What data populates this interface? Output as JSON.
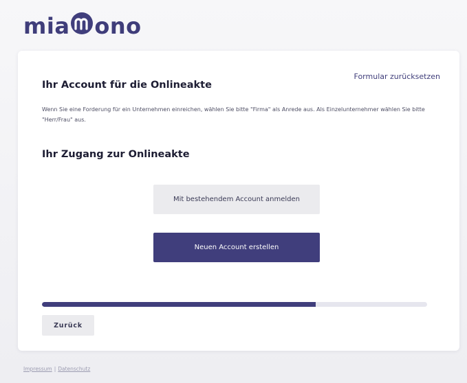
{
  "logo": {
    "text_before": "mia",
    "text_after": "ono"
  },
  "colors": {
    "brand": "#403e7c",
    "progress_track": "#e6e6ee",
    "secondary_button_bg": "#ebebee"
  },
  "card": {
    "reset_link": "Formular zurücksetzen",
    "title": "Ihr Account für die Onlineakte",
    "info": "Wenn Sie eine Forderung für ein Unternehmen einreichen, wählen Sie bitte \"Firma\" als Anrede aus. Als Einzelunternehmer wählen Sie bitte \"Herr/Frau\" aus.",
    "subtitle": "Ihr Zugang zur Onlineakte",
    "login_button": "Mit bestehendem Account anmelden",
    "create_button": "Neuen Account erstellen",
    "progress": 0.71,
    "back_button": "Zurück"
  },
  "footer": {
    "impressum": "Impressum",
    "separator": "|",
    "datenschutz": "Datenschutz"
  }
}
